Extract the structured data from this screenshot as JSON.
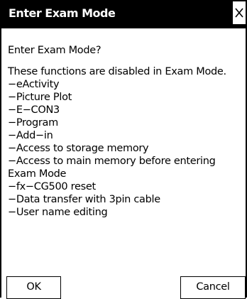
{
  "dialog": {
    "title": "Enter Exam Mode",
    "question": "Enter Exam Mode?",
    "intro": "These functions are disabled in Exam Mode.",
    "disabled_items": [
      "−eActivity",
      "−Picture Plot",
      "−E−CON3",
      "−Program",
      "−Add−in",
      "−Access to storage memory",
      "−Access to main memory before entering Exam Mode",
      "−fx−CG500 reset",
      "−Data transfer with 3pin cable",
      "−User name editing"
    ],
    "buttons": {
      "ok_label": "OK",
      "cancel_label": "Cancel"
    },
    "close_icon": "close-icon"
  }
}
